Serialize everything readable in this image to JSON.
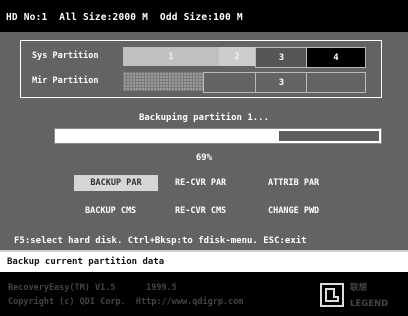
{
  "header": {
    "info": "HD No:1  All Size:2000 M  Odd Size:100 M"
  },
  "partitions": {
    "sys_label": "Sys Partition",
    "mir_label": "Mir Partition",
    "sys_cells": [
      "1",
      "2",
      "3",
      "4"
    ],
    "mir_cells": [
      "",
      "",
      "3",
      ""
    ]
  },
  "progress": {
    "status_text": "Backuping partition 1...",
    "percent_text": "69%",
    "fraction": 0.69
  },
  "menu": {
    "backup_par": "BACKUP PAR",
    "recover_par": "RE-CVR PAR",
    "attrib_par": "ATTRIB PAR",
    "backup_cmos": "BACKUP CMS",
    "recover_cmos": "RE-CVR CMS",
    "change_pwd": "CHANGE PWD"
  },
  "help": "F5:select hard disk. Ctrl+Bksp:to fdisk-menu. ESC:exit",
  "statusbar": "Backup current partition data",
  "footer": {
    "line1": "RecoveryEasy(TM) V1.5      1999.5",
    "line2": "Copyright (c) QDI Corp.  Http://www.qdigrp.com",
    "logo_cn": "联想",
    "logo_en": "LEGEND"
  },
  "colors": {
    "panel": "#636363",
    "highlight": "#d6d6d6"
  }
}
